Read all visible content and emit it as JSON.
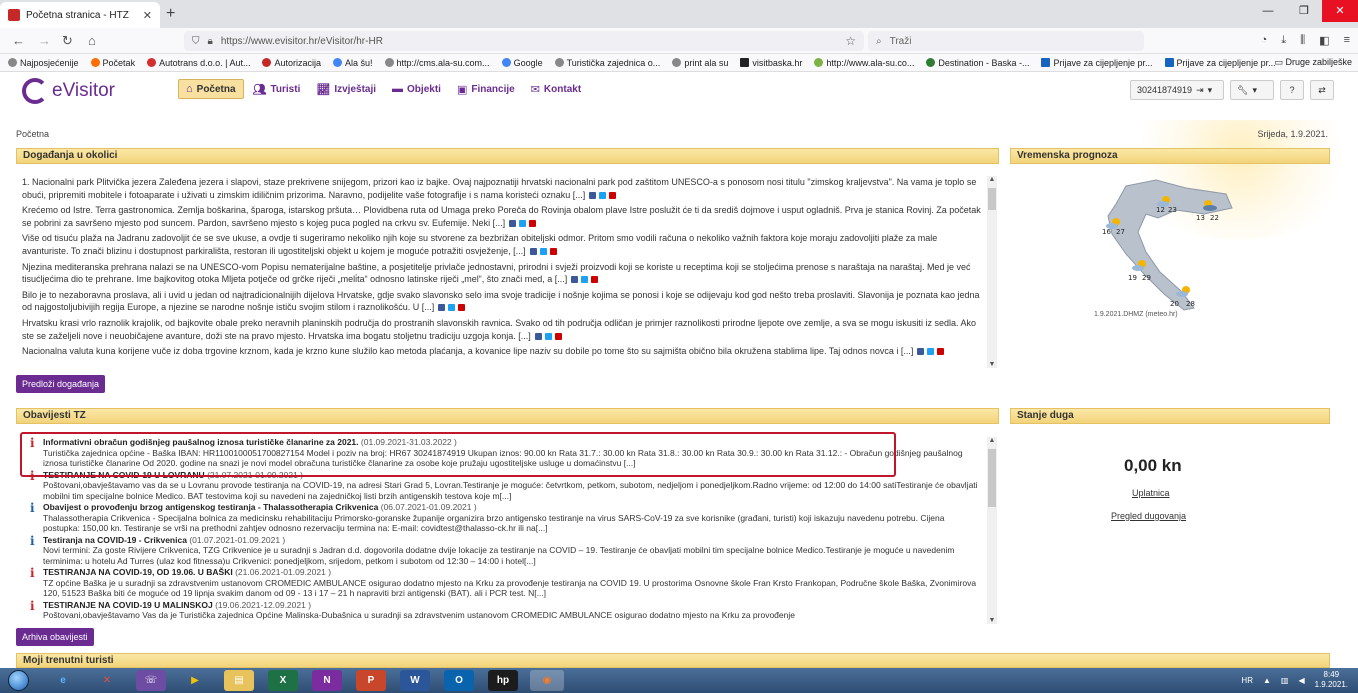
{
  "browser": {
    "tab_title": "Početna stranica - HTZ",
    "url": "https://www.evisitor.hr/eVisitor/hr-HR",
    "search_placeholder": "Traži",
    "bookmarks": [
      "Najposjećenije",
      "Početak",
      "Autotrans d.o.o. | Aut...",
      "Autorizacija",
      "Ala šu!",
      "http://cms.ala-su.com...",
      "Google",
      "Turistička zajednica o...",
      "print ala su",
      "visitbaska.hr",
      "http://www.ala-su.co...",
      "Destination - Baska -...",
      "Prijave za cijepljenje pr...",
      "Prijave za cijepljenje pr..."
    ],
    "bookmarks_other": "Druge zabilješke"
  },
  "app": {
    "logo_text": "eVisitor",
    "nav": [
      {
        "label": "Početna",
        "icon": "home-icon",
        "active": true
      },
      {
        "label": "Turisti",
        "icon": "users-icon"
      },
      {
        "label": "Izvještaji",
        "icon": "chart-icon"
      },
      {
        "label": "Objekti",
        "icon": "bed-icon"
      },
      {
        "label": "Financije",
        "icon": "money-icon"
      },
      {
        "label": "Kontakt",
        "icon": "mail-icon"
      }
    ],
    "user_id": "30241874919"
  },
  "breadcrumb": "Početna",
  "date": "Srijeda, 1.9.2021.",
  "events": {
    "title": "Događanja u okolici",
    "items": [
      "1. Nacionalni park Plitvička jezera Zaleđena jezera i slapovi, staze prekrivene snijegom, prizori kao iz bajke. Ovaj najpoznatiji hrvatski nacionalni park pod zaštitom UNESCO-a s ponosom nosi titulu \"zimskog kraljevstva\". Na vama je toplo se obući, pripremiti mobitele i fotoaparate i uživati u zimskim idiličnim prizorima. Naravno, podijelite vaše fotografije i s nama koristeći oznaku",
      "Krećemo od Istre. Terra gastronomica. Zemlja boškarina, šparoga, istarskog pršuta… Plovidbena ruta od Umaga preko Poreča do Rovinja obalom plave Istre poslužit će ti da središ dojmove i usput ogladniš. Prva je stanica Rovinj. Za početak se pobrini za savršeno mjesto pod suncem. Pardon, savršeno mjesto s kojeg puca pogled na crkvu sv. Eufemije. Neki",
      "Više od tisuću plaža na Jadranu zadovoljit će se sve ukuse, a ovdje ti sugeriramo nekoliko njih koje su stvorene za bezbrižan obiteljski odmor. Pritom smo vodili računa o nekoliko važnih faktora koje moraju zadovoljiti plaže za male avanturiste. To znači blizinu i dostupnost parkirališta, restoran ili ugostiteljski objekt u kojem je moguće potražiti osvježenje,",
      "Njezina mediteranska prehrana nalazi se na UNESCO-vom Popisu nematerijalne baštine, a posjetitelje privlače jednostavni, prirodni i svježi proizvodi koji se koriste u receptima koji se stoljećima prenose s naraštaja na naraštaj. Med je već tisućljećima dio te prehrane. Ime bajkovitog otoka Mljeta potječe od grčke riječi „meli̇ta“ odnosno latinske riječi „mel“, što znači med, a",
      "Bilo je to nezaboravna proslava, ali i uvid u jedan od najtradicionalnijih dijelova Hrvatske, gdje svako slavonsko selo ima svoje tradicije i nošnje kojima se ponosi i koje se odijevaju kod god nešto treba proslaviti. Slavonija je poznata kao jedna od najgostoljubivijih regija Europe, a njezine se narodne nošnje ističu svojim stilom i raznolikošću. U",
      "Hrvatsku krasi vrlo raznolik krajolik, od bajkovite obale preko neravnih planinskih područja do prostranih slavonskih ravnica. Svako od tih područja odličan je primjer raznolikosti prirodne ljepote ove zemlje, a sva se mogu iskusiti iz sedla. Ako ste se zaželjeli nove i neuobičajene avanture, doži ste na pravo mjesto. Hrvatska ima bogatu stoljetnu tradiciju uzgoja konja.",
      "Nacionalna valuta kuna korijene vuče iz doba trgovine krznom, kada je krzno kune služilo kao metoda plaćanja, a kovanice lipe naziv su dobile po tome što su sajmišta obično bila okružena stablima lipe. Taj odnos novca i"
    ],
    "more": "[...]",
    "button": "Predloži događanja"
  },
  "weather": {
    "title": "Vremenska prognoza",
    "temps": [
      {
        "min": "12",
        "max": "23"
      },
      {
        "min": "13",
        "max": "22"
      },
      {
        "min": "16",
        "max": "27"
      },
      {
        "min": "19",
        "max": "29"
      },
      {
        "min": "20",
        "max": "28"
      }
    ],
    "caption": "1.9.2021.DHMZ (meteo.hr)"
  },
  "notices": {
    "title": "Obavijesti TZ",
    "items": [
      {
        "title": "Informativni obračun godišnjeg paušalnog iznosa turističke članarine za 2021.",
        "date": "(01.09.2021-31.03.2022 )",
        "body": "Turistička zajednica općine - Baška IBAN: HR1100100051700827154 Model i poziv na broj: HR67 30241874919 Ukupan iznos: 90.00 kn Rata 31.7.: 30.00 kn Rata 31.8.: 30.00 kn Rata 30.9.: 30.00 kn Rata 31.12.: - Obračun godišnjeg paušalnog iznosa turističke članarine Od 2020. godine na snazi je novi model obračuna turističke članarine za osobe koje pružaju ugostiteljske usluge u domaćinstvu [...]",
        "color": "red"
      },
      {
        "title": "TESTIRANJE NA COVID-19 U LOVRANU",
        "date": "(21.07.2021-01.09.2021 )",
        "body": "Poštovani,obavještavamo vas da se u Lovranu provode testiranja na COVID-19, na adresi Stari Grad 5, Lovran.Testiranje je moguće: četvrtkom, petkom, subotom, nedjeljom i ponedjeljkom.Radno vrijeme: od 12:00 do 14:00 satiTestiranje će obavljati mobilni tim specijalne bolnice Medico. BAT testovima koji su navedeni na zajedničkoj listi brzih antigenskih testova koje m[...]",
        "color": "red"
      },
      {
        "title": "Obavijest o provođenju brzog antigenskog testiranja - Thalassotherapia Crikvenica",
        "date": "(06.07.2021-01.09.2021 )",
        "body": "Thalassotherapia Crikvenica - Specijalna bolnica za medicinsku rehabilitaciju Primorsko-goranske županije organizira brzo antigensko testiranje na virus SARS-CoV-19 za sve korisnike (građani, turisti) koji iskazuju navedenu potrebu. Cijena postupka: 150,00 kn. Testiranje se vrši na prethodni zahtjev odnosno rezervaciju termina na: E-mail: covidtest@thalasso-ck.hr ili na[...]",
        "color": "blue"
      },
      {
        "title": "Testiranja na COVID-19 - Crikvenica",
        "date": "(01.07.2021-01.09.2021 )",
        "body": "Novi termini: Za goste Rivijere Crikvenica, TZG Crikvenice je u suradnji s Jadran d.d. dogovorila dodatne dvije lokacije za testiranje na COVID – 19. Testiranje će obavljati mobilni tim specijalne bolnice Medico.Testiranje je moguće u navedenim terminima: u hotelu Ad Turres (ulaz kod fitnessa)u Crikvenici: ponedjeljkom, srijedom, petkom i subotom od 12:30 – 14:00 i hotel[...]",
        "color": "blue"
      },
      {
        "title": "TESTIRANJA NA COVID-19, OD 19.06. U BAŠKI",
        "date": "(21.06.2021-01.09.2021 )",
        "body": "TZ općine Baška je u suradnji sa zdravstvenim ustanovom CROMEDIC AMBULANCE osigurao dodatno mjesto na Krku za provođenje testiranja na COVID 19. U prostorima Osnovne škole Fran Krsto Frankopan, Područne škole Baška, Zvonimirova 120, 51523 Baška biti će moguće od 19 lipnja svakim danom od 09 - 13 i 17 – 21 h napraviti brzi antigenski (BAT). ali i PCR test. N[...]",
        "color": "red"
      },
      {
        "title": "TESTIRANJE NA COVID-19 U MALINSKOJ",
        "date": "(19.06.2021-12.09.2021 )",
        "body": "Poštovani,obavještavamo Vas da je Turistička zajednica Općine Malinska-Dubašnica u suradnji sa zdravstvenim ustanovom CROMEDIC AMBULANCE osigurao dodatno mjesto na Krku za provođenje",
        "color": "red"
      }
    ],
    "button": "Arhiva obavijesti"
  },
  "debt": {
    "title": "Stanje duga",
    "amount": "0,00 kn",
    "link1": "Uplatnica",
    "link2": "Pregled dugovanja"
  },
  "tourists": {
    "title": "Moji trenutni turisti"
  },
  "taskbar": {
    "lang": "HR",
    "time": "8:49",
    "date": "1.9.2021."
  }
}
